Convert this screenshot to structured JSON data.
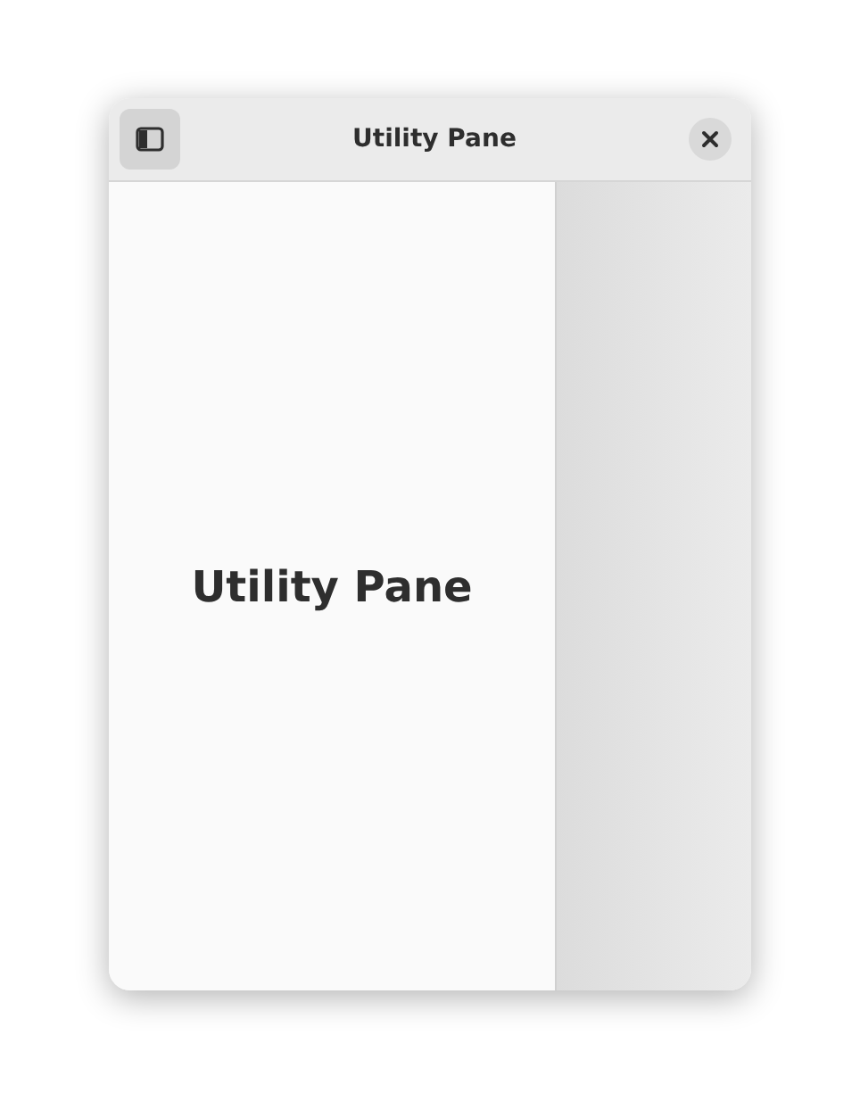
{
  "window": {
    "title": "Utility Pane"
  },
  "header": {
    "sidebar_toggle": {
      "selected": true
    }
  },
  "content": {
    "heading": "Utility Pane"
  }
}
